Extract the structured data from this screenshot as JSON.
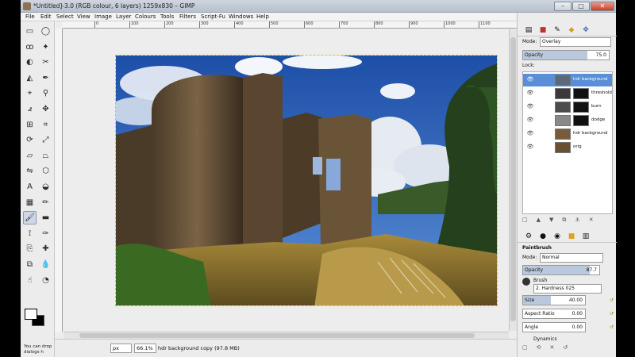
{
  "window": {
    "title": "*Untitled]-3.0 (RGB colour, 6 layers) 1259x830 – GIMP",
    "minimize": "–",
    "maximize": "□",
    "close": "✕"
  },
  "menu": [
    "File",
    "Edit",
    "Select",
    "View",
    "Image",
    "Layer",
    "Colours",
    "Tools",
    "Filters",
    "Script-Fu",
    "Windows",
    "Help"
  ],
  "ruler": {
    "marks": [
      "0",
      "100",
      "200",
      "300",
      "400",
      "500",
      "600",
      "700",
      "800",
      "900",
      "1000",
      "1100",
      "1200"
    ]
  },
  "toolbox": {
    "hint": "You can drop dialogs h",
    "tools": [
      "rect-select-icon",
      "ellipse-select-icon",
      "lasso-icon",
      "wand-icon",
      "color-select-icon",
      "scissors-icon",
      "foreground-select-icon",
      "paths-icon",
      "picker-icon",
      "zoom-icon",
      "measure-icon",
      "move-icon",
      "align-icon",
      "crop-icon",
      "rotate-icon",
      "scale-icon",
      "shear-icon",
      "perspective-icon",
      "flip-icon",
      "cage-icon",
      "text-icon",
      "bucket-icon",
      "blend-icon",
      "pencil-icon",
      "paintbrush-icon",
      "eraser-icon",
      "airbrush-icon",
      "ink-icon",
      "clone-icon",
      "heal-icon",
      "perspective-clone-icon",
      "blur-icon",
      "smudge-icon",
      "dodge-icon"
    ]
  },
  "status": {
    "unit": "px",
    "zoom": "66.1%",
    "message": "hdr background copy (97.8 MB)"
  },
  "layers_panel": {
    "mode_label": "Mode:",
    "mode_value": "Overlay",
    "opacity_label": "Opacity",
    "opacity_value": "75.0",
    "opacity_fraction": 0.75,
    "lock_label": "Lock:",
    "layers": [
      {
        "name": "hdr background",
        "selected": true,
        "mask": false,
        "thumb": "#5a6a78"
      },
      {
        "name": "threshold",
        "selected": false,
        "mask": true,
        "thumb": "#3a3a3a"
      },
      {
        "name": "burn",
        "selected": false,
        "mask": true,
        "thumb": "#4c4c4c"
      },
      {
        "name": "dodge",
        "selected": false,
        "mask": true,
        "thumb": "#888888"
      },
      {
        "name": "hdr background",
        "selected": false,
        "mask": false,
        "thumb": "#7a5a3a"
      },
      {
        "name": "orig",
        "selected": false,
        "mask": false,
        "thumb": "#6a5030"
      }
    ]
  },
  "tool_options": {
    "title": "Paintbrush",
    "mode_label": "Mode:",
    "mode_value": "Normal",
    "opacity_label": "Opacity",
    "opacity_value": "87.7",
    "opacity_fraction": 0.877,
    "brush_label": "Brush",
    "brush_value": "2. Hardness 025",
    "size_label": "Size",
    "size_value": "40.00",
    "size_fraction": 0.45,
    "aspect_label": "Aspect Ratio",
    "aspect_value": "0.00",
    "angle_label": "Angle",
    "angle_value": "0.00",
    "dynamics_label": "Dynamics"
  },
  "colors": {
    "selection": "#5a8fd8",
    "canvas_bg": "#ededed",
    "marching_ants": "#d8c030"
  }
}
